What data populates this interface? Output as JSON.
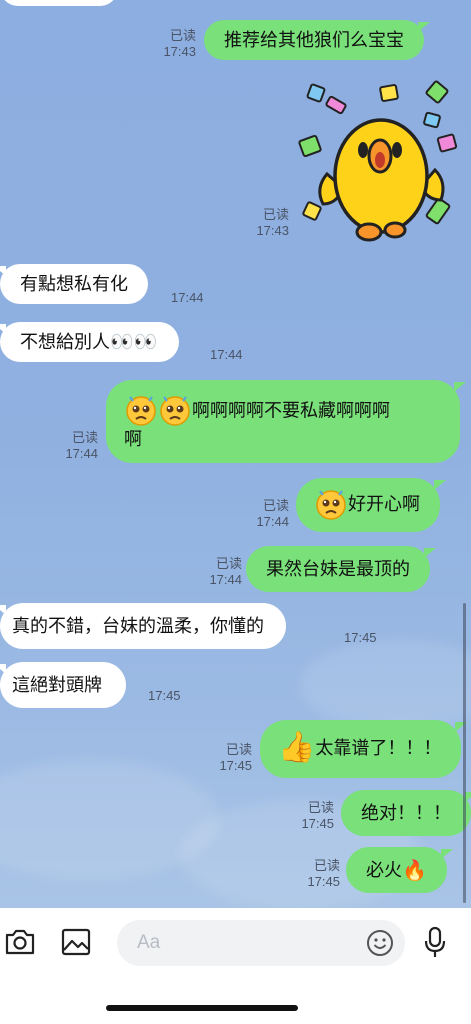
{
  "colors": {
    "outgoing_bubble": "#79e07a",
    "incoming_bubble": "#ffffff",
    "chat_background": "#8fb0e0"
  },
  "messages": [
    {
      "direction": "out",
      "text": "推荐给其他狼们么宝宝",
      "read": "已读",
      "time": "17:43"
    },
    {
      "direction": "out",
      "type": "sticker",
      "sticker": "sally-duck-celebrating-sticker",
      "read": "已读",
      "time": "17:43"
    },
    {
      "direction": "in",
      "text": "有點想私有化",
      "time": "17:44"
    },
    {
      "direction": "in",
      "text": "不想給別人👀👀",
      "time": "17:44"
    },
    {
      "direction": "out",
      "text_line1": "🥺🥺啊啊啊啊不要私藏啊啊啊",
      "text_line2": "啊",
      "read": "已读",
      "time": "17:44"
    },
    {
      "direction": "out",
      "text": "🥺好开心啊",
      "read": "已读",
      "time": "17:44"
    },
    {
      "direction": "out",
      "text": "果然台妹是最顶的",
      "read": "已读",
      "time": "17:44"
    },
    {
      "direction": "in",
      "text": "真的不錯，台妹的溫柔，你懂的",
      "time": "17:45"
    },
    {
      "direction": "in",
      "text": "這絕對頭牌",
      "time": "17:45"
    },
    {
      "direction": "out",
      "text": "👍太靠谱了！！！",
      "read": "已读",
      "time": "17:45"
    },
    {
      "direction": "out",
      "text": "绝对！！！",
      "read": "已读",
      "time": "17:45"
    },
    {
      "direction": "out",
      "text": "必火🔥",
      "read": "已读",
      "time": "17:45"
    }
  ],
  "m1": {
    "text": "推荐给其他狼们么宝宝",
    "read": "已读",
    "time": "17:43"
  },
  "m2": {
    "read": "已读",
    "time": "17:43"
  },
  "m3": {
    "text": "有點想私有化",
    "time": "17:44"
  },
  "m4": {
    "text": "不想給別人",
    "eyes": "👀👀",
    "time": "17:44"
  },
  "m5": {
    "text_line1": "啊啊啊啊不要私藏啊啊啊",
    "text_line2": "啊",
    "read": "已读",
    "time": "17:44"
  },
  "m6": {
    "text": "好开心啊",
    "read": "已读",
    "time": "17:44"
  },
  "m7": {
    "text": "果然台妹是最顶的",
    "read": "已读",
    "time": "17:44"
  },
  "m8": {
    "text": "真的不錯，台妹的溫柔，你懂的",
    "time": "17:45"
  },
  "m9": {
    "text": "這絕對頭牌",
    "time": "17:45"
  },
  "m10": {
    "thumb": "👍",
    "text": "太靠谱了！！！",
    "read": "已读",
    "time": "17:45"
  },
  "m11": {
    "text": "绝对！！！",
    "read": "已读",
    "time": "17:45"
  },
  "m12": {
    "text": "必火",
    "fire": "🔥",
    "read": "已读",
    "time": "17:45"
  },
  "input": {
    "placeholder": "Aa"
  },
  "icons": [
    "camera-icon",
    "image-icon",
    "emoji-icon",
    "microphone-icon"
  ]
}
